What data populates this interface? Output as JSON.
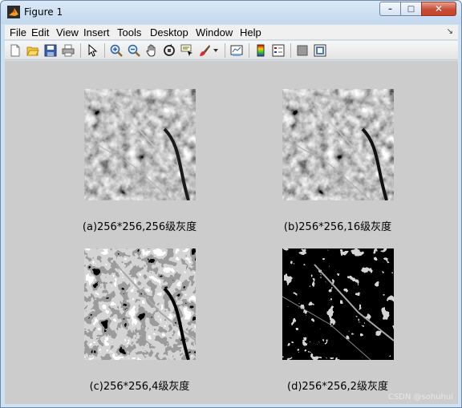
{
  "window": {
    "title": "Figure 1",
    "minimize_glyph": "–",
    "maximize_glyph": "□",
    "close_glyph": "✕"
  },
  "menu": {
    "items": [
      "File",
      "Edit",
      "View",
      "Insert",
      "Tools",
      "Desktop",
      "Window",
      "Help"
    ],
    "dock_glyph": "↘"
  },
  "toolbar": {
    "icons": [
      "new-figure-icon",
      "open-file-icon",
      "save-icon",
      "print-icon",
      "edit-plot-icon",
      "zoom-in-icon",
      "zoom-out-icon",
      "pan-icon",
      "rotate-3d-icon",
      "data-cursor-icon",
      "brush-icon",
      "brush-dropdown-icon",
      "link-plot-icon",
      "colorbar-icon",
      "legend-icon",
      "hide-plot-tools-icon",
      "show-plot-tools-icon"
    ]
  },
  "figure": {
    "captions": {
      "a": "(a)256*256,256级灰度",
      "b": "(b)256*256,16级灰度",
      "c": "(c)256*256,4级灰度",
      "d": "(d)256*256,2级灰度"
    },
    "watermark": "CSDN @sohuhui"
  },
  "colors": {
    "canvas": "#cccccc",
    "menubar": "#f0f0f0",
    "titlebar": "#c3d8ee"
  }
}
